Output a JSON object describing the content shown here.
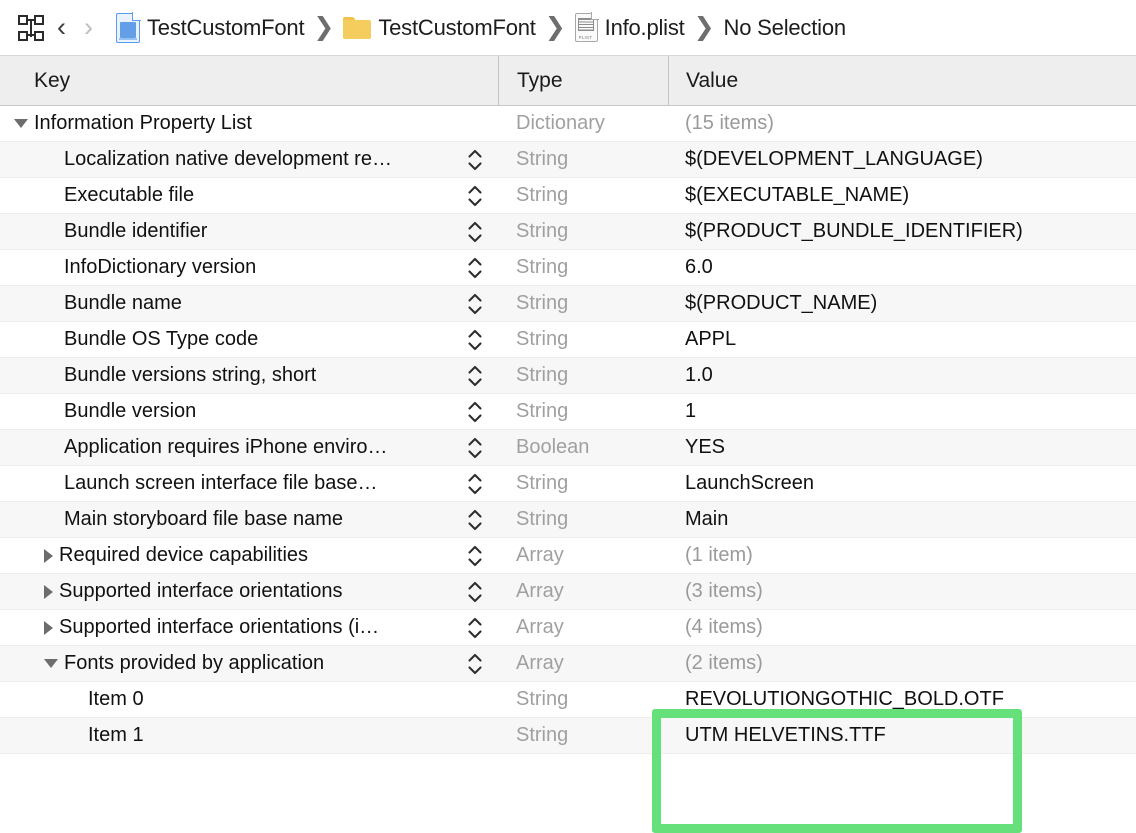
{
  "jumpbar": {
    "navigator_toggle_icon": "grid-icon",
    "back_label": "‹",
    "forward_label": "›",
    "separator": "❯",
    "crumbs": [
      {
        "icon": "xcode-project-icon",
        "label": "TestCustomFont"
      },
      {
        "icon": "folder-icon",
        "label": "TestCustomFont"
      },
      {
        "icon": "plist-file-icon",
        "label": "Info.plist"
      },
      {
        "icon": "none",
        "label": "No Selection"
      }
    ],
    "plist_icon_tag": "PLIST"
  },
  "table": {
    "columns": [
      "Key",
      "Type",
      "Value"
    ],
    "rows": [
      {
        "key": "Information Property List",
        "type": "Dictionary",
        "value": "(15 items)",
        "indent": 0,
        "disclosure": "open",
        "stepper": false,
        "value_muted": true
      },
      {
        "key": "Localization native development re…",
        "type": "String",
        "value": "$(DEVELOPMENT_LANGUAGE)",
        "indent": 1,
        "disclosure": "none",
        "stepper": true,
        "value_muted": false
      },
      {
        "key": "Executable file",
        "type": "String",
        "value": "$(EXECUTABLE_NAME)",
        "indent": 1,
        "disclosure": "none",
        "stepper": true,
        "value_muted": false
      },
      {
        "key": "Bundle identifier",
        "type": "String",
        "value": "$(PRODUCT_BUNDLE_IDENTIFIER)",
        "indent": 1,
        "disclosure": "none",
        "stepper": true,
        "value_muted": false
      },
      {
        "key": "InfoDictionary version",
        "type": "String",
        "value": "6.0",
        "indent": 1,
        "disclosure": "none",
        "stepper": true,
        "value_muted": false
      },
      {
        "key": "Bundle name",
        "type": "String",
        "value": "$(PRODUCT_NAME)",
        "indent": 1,
        "disclosure": "none",
        "stepper": true,
        "value_muted": false
      },
      {
        "key": "Bundle OS Type code",
        "type": "String",
        "value": "APPL",
        "indent": 1,
        "disclosure": "none",
        "stepper": true,
        "value_muted": false
      },
      {
        "key": "Bundle versions string, short",
        "type": "String",
        "value": "1.0",
        "indent": 1,
        "disclosure": "none",
        "stepper": true,
        "value_muted": false
      },
      {
        "key": "Bundle version",
        "type": "String",
        "value": "1",
        "indent": 1,
        "disclosure": "none",
        "stepper": true,
        "value_muted": false
      },
      {
        "key": "Application requires iPhone enviro…",
        "type": "Boolean",
        "value": "YES",
        "indent": 1,
        "disclosure": "none",
        "stepper": true,
        "value_muted": false
      },
      {
        "key": "Launch screen interface file base…",
        "type": "String",
        "value": "LaunchScreen",
        "indent": 1,
        "disclosure": "none",
        "stepper": true,
        "value_muted": false
      },
      {
        "key": "Main storyboard file base name",
        "type": "String",
        "value": "Main",
        "indent": 1,
        "disclosure": "none",
        "stepper": true,
        "value_muted": false
      },
      {
        "key": "Required device capabilities",
        "type": "Array",
        "value": "(1 item)",
        "indent": 1,
        "disclosure": "closed",
        "stepper": true,
        "value_muted": true
      },
      {
        "key": "Supported interface orientations",
        "type": "Array",
        "value": "(3 items)",
        "indent": 1,
        "disclosure": "closed",
        "stepper": true,
        "value_muted": true
      },
      {
        "key": "Supported interface orientations (i…",
        "type": "Array",
        "value": "(4 items)",
        "indent": 1,
        "disclosure": "closed",
        "stepper": true,
        "value_muted": true
      },
      {
        "key": "Fonts provided by application",
        "type": "Array",
        "value": "(2 items)",
        "indent": 1,
        "disclosure": "open",
        "stepper": true,
        "value_muted": true
      },
      {
        "key": "Item 0",
        "type": "String",
        "value": "REVOLUTIONGOTHIC_BOLD.OTF",
        "indent": 2,
        "disclosure": "none",
        "stepper": false,
        "value_muted": false
      },
      {
        "key": "Item 1",
        "type": "String",
        "value": "UTM HELVETINS.TTF",
        "indent": 2,
        "disclosure": "none",
        "stepper": false,
        "value_muted": false
      }
    ]
  },
  "annotation": {
    "name": "green-highlight-box",
    "color": "#66e07a"
  }
}
